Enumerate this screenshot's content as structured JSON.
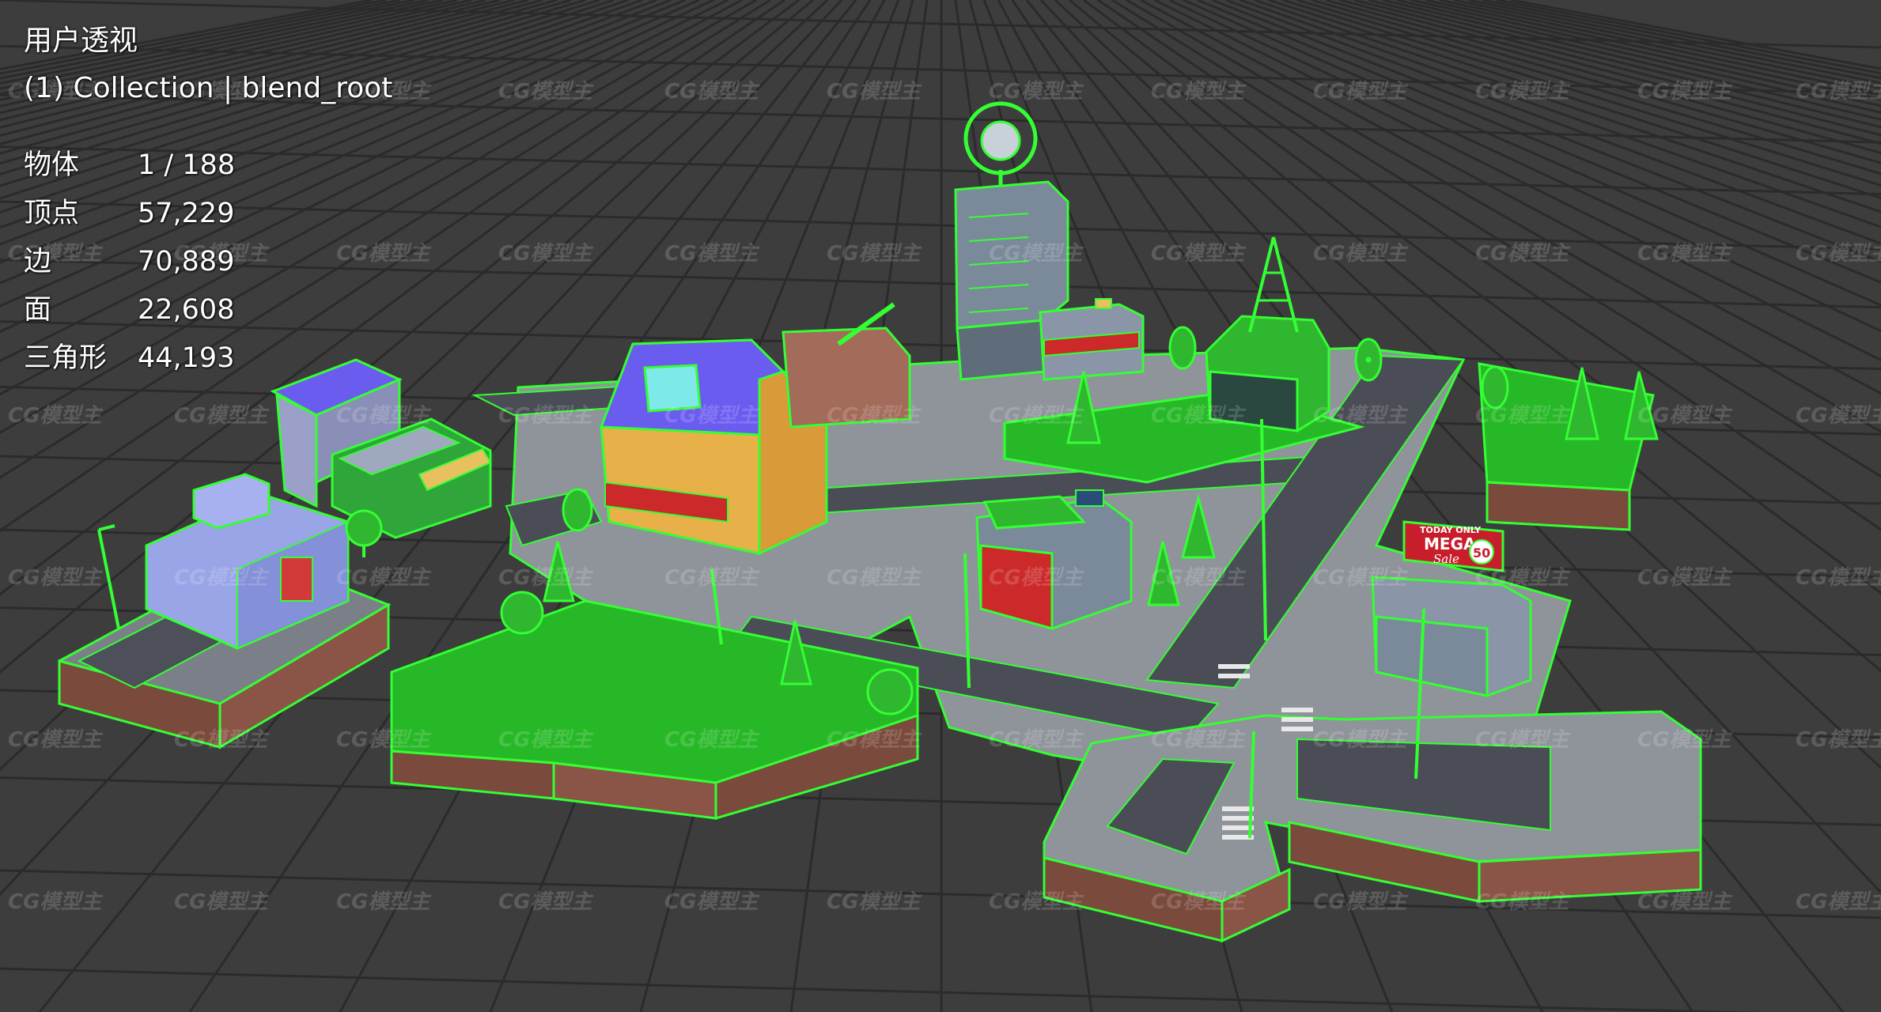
{
  "viewport": {
    "view_title": "用户透视",
    "collection_label": "(1) Collection | blend_root"
  },
  "stats": [
    {
      "label": "物体",
      "value": "1 / 188"
    },
    {
      "label": "顶点",
      "value": "57,229"
    },
    {
      "label": "边",
      "value": "70,889"
    },
    {
      "label": "面",
      "value": "22,608"
    },
    {
      "label": "三角形",
      "value": "44,193"
    }
  ],
  "watermark": {
    "text": "CG模型主"
  },
  "billboard": {
    "line1": "TODAY ONLY",
    "line2": "MEGA",
    "line3": "Sale",
    "badge": "50"
  },
  "colors": {
    "background": "#3d3d3d",
    "grid_line": "#2c2c2c",
    "selection_green": "#2ee82e",
    "selection_fill": "#27b827",
    "road": "#4a4d55",
    "dirt": "#7a4a3c"
  }
}
